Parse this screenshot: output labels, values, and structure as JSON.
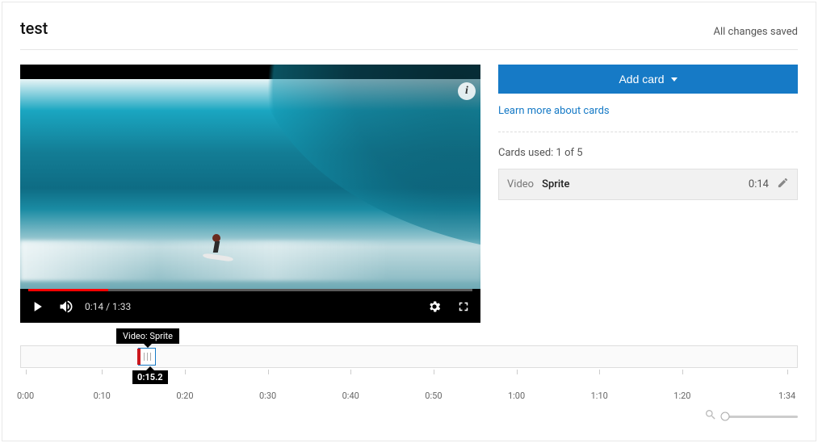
{
  "header": {
    "title": "test",
    "save_status": "All changes saved"
  },
  "player": {
    "current_time": "0:14",
    "duration": "1:33",
    "info_badge": "i"
  },
  "side": {
    "add_card_label": "Add card",
    "learn_link": "Learn more about cards",
    "cards_used_label": "Cards used: 1 of 5",
    "card": {
      "type": "Video",
      "title": "Sprite",
      "time": "0:14"
    }
  },
  "timeline": {
    "tooltip": "Video: Sprite",
    "playhead_label": "0:15.2",
    "ticks": [
      "0:00",
      "0:10",
      "0:20",
      "0:30",
      "0:40",
      "0:50",
      "1:00",
      "1:10",
      "1:20",
      "1:34"
    ],
    "duration_seconds": 94,
    "marker_seconds": 15.2
  }
}
